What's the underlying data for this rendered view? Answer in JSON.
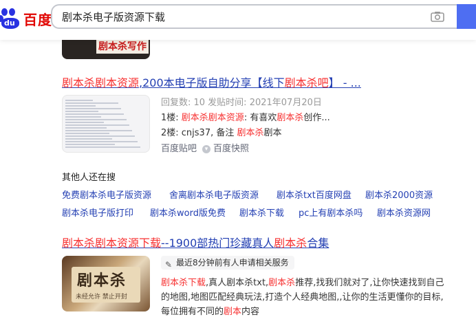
{
  "header": {
    "logo_du": "du",
    "logo_text": "百度",
    "search_value": "剧本杀电子版资源下载"
  },
  "top_result": {
    "thumb_label": "剧本杀写作"
  },
  "result1": {
    "title_parts": [
      "剧本杀剧本资源",
      ",200本电子版自助分享【线下",
      "剧本杀吧",
      "】 - ..."
    ],
    "reply_info": "回复数: 10 发贴时间: 2021年07月20日",
    "line1_prefix": "1楼: ",
    "line1_em1": "剧本杀剧本资源",
    "line1_mid": ": 有喜欢",
    "line1_em2": "剧本杀",
    "line1_suffix": "创作...",
    "line2_prefix": "2楼: cnjs37, 备注 ",
    "line2_em": "剧本杀",
    "line2_suffix": "剧本",
    "source": "百度贴吧",
    "snapshot": "百度快照"
  },
  "also_search": {
    "title": "其他人还在搜",
    "row1": [
      "免费剧本杀电子版资源",
      "舍离剧本杀电子版资源",
      "剧本杀txt百度网盘",
      "剧本杀2000资源"
    ],
    "row2": [
      "剧本杀电子版打印",
      "剧本杀word版免费",
      "剧本杀下载",
      "pc上有剧本杀吗",
      "剧本杀资源网"
    ]
  },
  "result2": {
    "title_parts": [
      "剧本杀剧本资源下载",
      "--1900部热门珍藏真人",
      "剧本杀",
      "合集"
    ],
    "badge": "最近8分钟前有人申请相关服务",
    "thumb_big": "剧本杀",
    "thumb_small": "未经允许  禁止开封",
    "desc1_em1": "剧本杀下载",
    "desc1_mid": ",真人剧本杀txt,",
    "desc1_em2": "剧本杀",
    "desc1_suffix": "推荐,找我们就对了,让你快速找到自己",
    "desc2": "的地图,地图匹配经典玩法,打造个人经典地图,,让你的生活更懂你的目标,",
    "desc3_prefix": "每位拥有不同的",
    "desc3_em": "剧本",
    "desc3_suffix": "内容"
  }
}
